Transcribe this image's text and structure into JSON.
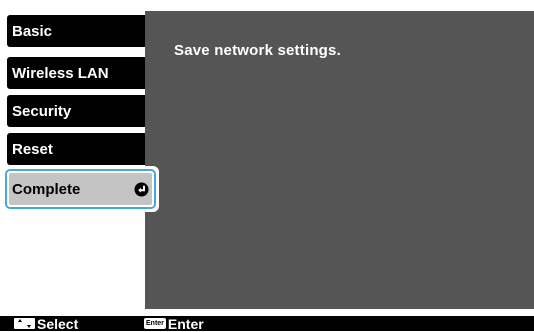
{
  "menu": {
    "items": [
      {
        "label": "Basic"
      },
      {
        "label": "Wireless LAN"
      },
      {
        "label": "Security"
      },
      {
        "label": "Reset"
      },
      {
        "label": "Complete",
        "selected": true
      }
    ]
  },
  "main": {
    "message": "Save network settings."
  },
  "footer": {
    "select_label": "Select",
    "enter_key_label": "Enter",
    "enter_label": "Enter"
  },
  "icons": {
    "selected_item_icon": "return-arrow-icon",
    "select_key_icon": "up-down-arrow-key-icon",
    "enter_key_icon": "enter-key-icon"
  },
  "colors": {
    "panel_background": "#555555",
    "menu_item_background": "#000000",
    "selected_item_background": "#c4c4c4",
    "selection_border": "#49a9d6",
    "footer_background": "#000000"
  }
}
